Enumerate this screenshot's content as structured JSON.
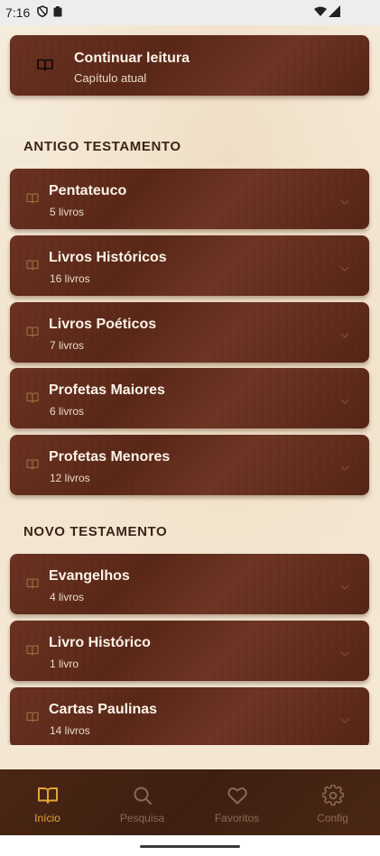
{
  "status_bar": {
    "time": "7:16",
    "left_icons": [
      "shield-icon",
      "clipboard-icon"
    ],
    "right_icons": [
      "wifi-icon",
      "signal-icon"
    ]
  },
  "continue_card": {
    "title": "Continuar leitura",
    "subtitle": "Capítulo atual",
    "icon": "book-open-icon"
  },
  "old_testament": {
    "heading": "ANTIGO TESTAMENTO",
    "groups": [
      {
        "title": "Pentateuco",
        "count": "5 livros"
      },
      {
        "title": "Livros Históricos",
        "count": "16 livros"
      },
      {
        "title": "Livros Poéticos",
        "count": "7 livros"
      },
      {
        "title": "Profetas Maiores",
        "count": "6 livros"
      },
      {
        "title": "Profetas Menores",
        "count": "12 livros"
      }
    ]
  },
  "new_testament": {
    "heading": "NOVO TESTAMENTO",
    "groups": [
      {
        "title": "Evangelhos",
        "count": "4 livros"
      },
      {
        "title": "Livro Histórico",
        "count": "1 livro"
      },
      {
        "title": "Cartas Paulinas",
        "count": "14 livros"
      }
    ]
  },
  "bottom_nav": {
    "items": [
      {
        "label": "Início",
        "icon": "book-open-icon",
        "active": true
      },
      {
        "label": "Pesquisa",
        "icon": "search-icon",
        "active": false
      },
      {
        "label": "Favoritos",
        "icon": "heart-icon",
        "active": false
      },
      {
        "label": "Config",
        "icon": "gear-icon",
        "active": false
      }
    ]
  },
  "colors": {
    "accent": "#e0a535",
    "card": "#5e2b1b",
    "nav_bg": "#43220f",
    "page_bg": "#f3e7d3"
  }
}
